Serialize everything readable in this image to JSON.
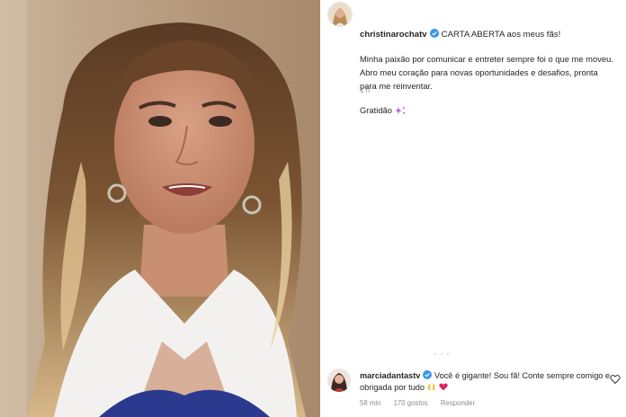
{
  "post": {
    "username": "christinarochatv",
    "caption_headline": "CARTA ABERTA aos meus fãs!",
    "caption_body": "Minha paixão por comunicar e entreter sempre foi o que me moveu. Abro meu coração para novas oportunidades e desafios, pronta para me reinventar.",
    "caption_signoff": "Gratidão",
    "time": "1 h"
  },
  "comment": {
    "username": "marciadantastv",
    "text": "Você é gigante! Sou fã! Conte sempre comigo e obrigada por tudo",
    "time": "58 min",
    "likes": "170 gostos",
    "reply": "Responder"
  },
  "icons": {
    "verified": "verified-badge-icon",
    "sparkle": "sparkles-emoji-icon",
    "raised_hands": "raised-hands-emoji-icon",
    "heart_emoji": "red-heart-emoji-icon",
    "like": "heart-outline-icon"
  },
  "colors": {
    "verified_blue": "#3897f0",
    "text_primary": "#262626",
    "text_secondary": "#8e8e8e"
  }
}
